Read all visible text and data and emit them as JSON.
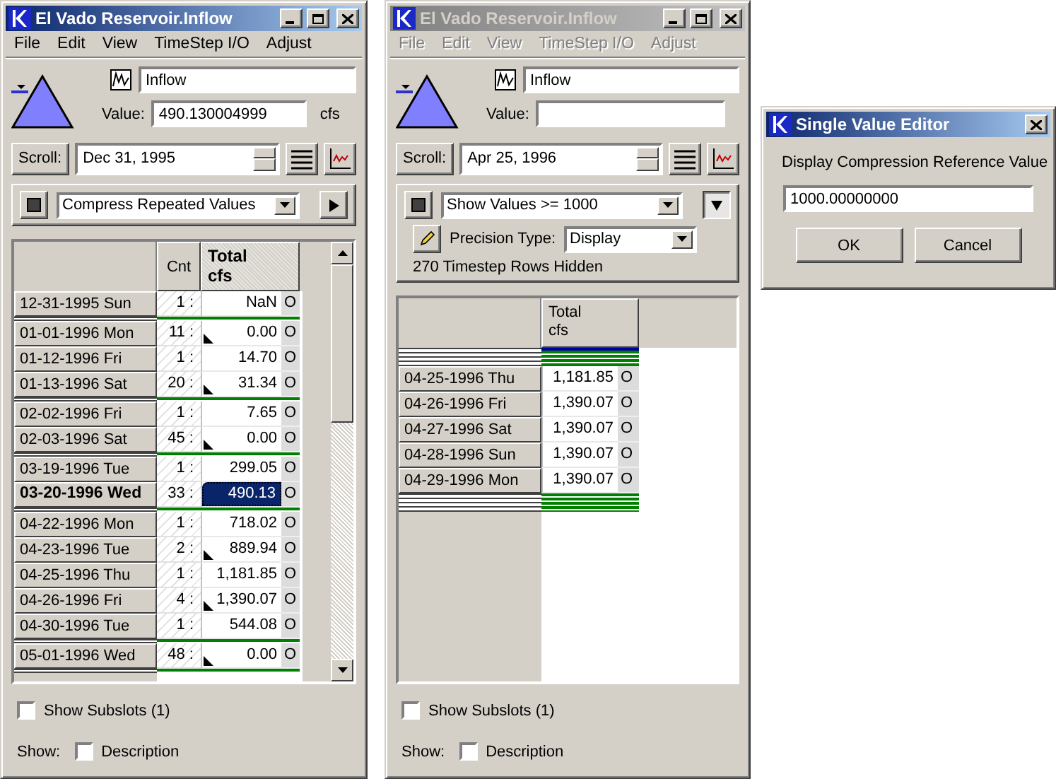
{
  "windows": [
    {
      "title": "El Vado Reservoir.Inflow",
      "active": true,
      "menus": [
        "File",
        "Edit",
        "View",
        "TimeStep I/O",
        "Adjust"
      ],
      "name_field": {
        "value": "Inflow"
      },
      "value_field": {
        "label": "Value:",
        "value": "490.130004999"
      },
      "units": "cfs",
      "scroll": {
        "label": "Scroll:",
        "date": "Dec 31, 1995"
      },
      "filter": {
        "mode": "Compress Repeated Values",
        "expanded": false
      },
      "table": {
        "count_header": "Cnt",
        "value_header": "Total\ncfs",
        "value_column_selected": true,
        "hidden_before": false,
        "hidden_after": false,
        "scrollbar": true,
        "rows": [
          {
            "date": "12-31-1995 Sun",
            "count": "1 :",
            "value": "NaN",
            "flag": "O",
            "marker": false,
            "selected": false,
            "group_end": true
          },
          {
            "date": "01-01-1996 Mon",
            "count": "11 :",
            "value": "0.00",
            "flag": "O",
            "marker": true,
            "selected": false,
            "group_end": false
          },
          {
            "date": "01-12-1996 Fri",
            "count": "1 :",
            "value": "14.70",
            "flag": "O",
            "marker": false,
            "selected": false,
            "group_end": false
          },
          {
            "date": "01-13-1996 Sat",
            "count": "20 :",
            "value": "31.34",
            "flag": "O",
            "marker": true,
            "selected": false,
            "group_end": true
          },
          {
            "date": "02-02-1996 Fri",
            "count": "1 :",
            "value": "7.65",
            "flag": "O",
            "marker": false,
            "selected": false,
            "group_end": false
          },
          {
            "date": "02-03-1996 Sat",
            "count": "45 :",
            "value": "0.00",
            "flag": "O",
            "marker": true,
            "selected": false,
            "group_end": true
          },
          {
            "date": "03-19-1996 Tue",
            "count": "1 :",
            "value": "299.05",
            "flag": "O",
            "marker": false,
            "selected": false,
            "group_end": false
          },
          {
            "date": "03-20-1996 Wed",
            "count": "33 :",
            "value": "490.13",
            "flag": "O",
            "marker": false,
            "selected": true,
            "group_end": true
          },
          {
            "date": "04-22-1996 Mon",
            "count": "1 :",
            "value": "718.02",
            "flag": "O",
            "marker": false,
            "selected": false,
            "group_end": false
          },
          {
            "date": "04-23-1996 Tue",
            "count": "2 :",
            "value": "889.94",
            "flag": "O",
            "marker": true,
            "selected": false,
            "group_end": false
          },
          {
            "date": "04-25-1996 Thu",
            "count": "1 :",
            "value": "1,181.85",
            "flag": "O",
            "marker": false,
            "selected": false,
            "group_end": false
          },
          {
            "date": "04-26-1996 Fri",
            "count": "4 :",
            "value": "1,390.07",
            "flag": "O",
            "marker": true,
            "selected": false,
            "group_end": false
          },
          {
            "date": "04-30-1996 Tue",
            "count": "1 :",
            "value": "544.08",
            "flag": "O",
            "marker": false,
            "selected": false,
            "group_end": true
          },
          {
            "date": "05-01-1996 Wed",
            "count": "48 :",
            "value": "0.00",
            "flag": "O",
            "marker": true,
            "selected": false,
            "group_end": true
          }
        ]
      },
      "show_subslots": {
        "label": "Show Subslots (1)",
        "checked": false
      },
      "show": {
        "label": "Show:",
        "option": "Description",
        "checked": false
      }
    },
    {
      "title": "El Vado Reservoir.Inflow",
      "active": false,
      "menus": [
        "File",
        "Edit",
        "View",
        "TimeStep I/O",
        "Adjust"
      ],
      "name_field": {
        "value": "Inflow"
      },
      "value_field": {
        "label": "Value:"
      },
      "scroll": {
        "label": "Scroll:",
        "date": "Apr 25, 1996"
      },
      "filter": {
        "mode": "Show Values >= 1000",
        "expanded": true,
        "precision_label": "Precision Type:",
        "precision": "Display",
        "status": "270 Timestep Rows Hidden"
      },
      "table": {
        "value_header": "Total\ncfs",
        "value_column_selected": false,
        "hidden_before": true,
        "hidden_after": true,
        "scrollbar": false,
        "rows": [
          {
            "date": "04-25-1996 Thu",
            "value": "1,181.85",
            "flag": "O",
            "marker": false,
            "selected": false,
            "group_end": false
          },
          {
            "date": "04-26-1996 Fri",
            "value": "1,390.07",
            "flag": "O",
            "marker": false,
            "selected": false,
            "group_end": false
          },
          {
            "date": "04-27-1996 Sat",
            "value": "1,390.07",
            "flag": "O",
            "marker": false,
            "selected": false,
            "group_end": false
          },
          {
            "date": "04-28-1996 Sun",
            "value": "1,390.07",
            "flag": "O",
            "marker": false,
            "selected": false,
            "group_end": false
          },
          {
            "date": "04-29-1996 Mon",
            "value": "1,390.07",
            "flag": "O",
            "marker": false,
            "selected": false,
            "group_end": false
          }
        ]
      },
      "show_subslots": {
        "label": "Show Subslots (1)",
        "checked": false
      },
      "show": {
        "label": "Show:",
        "option": "Description",
        "checked": false
      }
    }
  ],
  "dialog": {
    "title": "Single Value Editor",
    "prompt": "Display Compression Reference Value",
    "value": "1000.00000000",
    "buttons": [
      "OK",
      "Cancel"
    ]
  }
}
